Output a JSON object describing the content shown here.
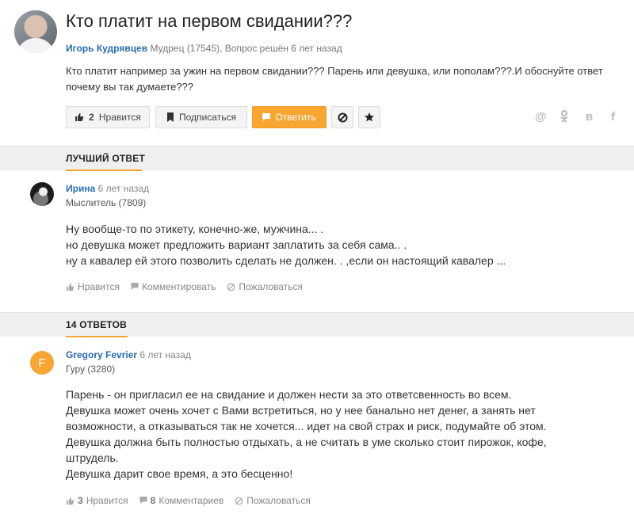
{
  "question": {
    "title": "Кто платит на первом свидании???",
    "author": "Игорь Кудрявцев",
    "author_rank": "Мудрец (17545), Вопрос решён 6 лет назад",
    "text": "Кто платит например за ужин на первом свидании??? Парень или девушка, или пополам???.И обоснуйте ответ почему вы так думаете???"
  },
  "toolbar": {
    "like_count": "2",
    "like_label": "Нравится",
    "subscribe_label": "Подписаться",
    "answer_label": "Ответить"
  },
  "share": {
    "mail": "@",
    "ok": "ok",
    "vk": "в",
    "fb": "f"
  },
  "best_section": {
    "label": "ЛУЧШИЙ ОТВЕТ"
  },
  "best_answer": {
    "name": "Ирина",
    "time": "6 лет назад",
    "rank": "Мыслитель (7809)",
    "lines": [
      "Ну вообще-то по этикету, конечно-же, мужчина... .",
      "но девушка может предложить вариант заплатить за себя сама.. .",
      "ну а кавалер ей этого позволить сделать не должен. . ,если он настоящий кавалер ..."
    ],
    "like_label": "Нравится",
    "comment_label": "Комментировать",
    "report_label": "Пожаловаться"
  },
  "answers_section": {
    "label": "14 ОТВЕТОВ"
  },
  "answer2": {
    "avatar_letter": "F",
    "name": "Gregory Fevrier",
    "time": "6 лет назад",
    "rank": "Гуру (3280)",
    "lines": [
      "Парень - он пригласил ее на свидание и должен нести за это ответсвенность во всем.",
      "Девушка может очень хочет с Вами встретиться, но у нее банально нет денег, а занять нет",
      "возможности, а отказываться так не хочется... идет на свой страх и риск, подумайте об этом.",
      "Девушка должна быть полностью отдыхать, а не считать в уме сколько стоит пирожок, кофе,",
      "штрудель.",
      "Девушка дарит свое время, а это бесценно!"
    ],
    "like_count": "3",
    "like_label": "Нравится",
    "comment_count": "8",
    "comment_label": "Комментариев",
    "report_label": "Пожаловаться"
  },
  "colors": {
    "accent": "#f8a532",
    "link": "#2a6db0",
    "avatar_f": "#f8a532"
  }
}
